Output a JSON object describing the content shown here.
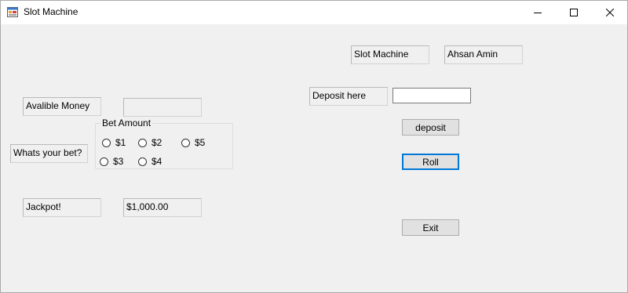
{
  "window": {
    "title": "Slot Machine",
    "minimize_glyph": "—",
    "maximize_glyph": "☐",
    "close_glyph": "✕"
  },
  "header": {
    "title_label": "Slot Machine",
    "author_label": "Ahsan Amin"
  },
  "money": {
    "label": "Avalible Money",
    "value": ""
  },
  "bet": {
    "question": "Whats your bet?",
    "group_title": "Bet Amount",
    "options": [
      "$1",
      "$2",
      "$5",
      "$3",
      "$4"
    ]
  },
  "jackpot": {
    "label": "Jackpot!",
    "value": "$1,000.00"
  },
  "deposit": {
    "label": "Deposit here",
    "input_value": "",
    "button_label": "deposit"
  },
  "actions": {
    "roll_label": "Roll",
    "exit_label": "Exit"
  },
  "colors": {
    "window_bg": "#f0f0f0",
    "titlebar_bg": "#ffffff",
    "default_button_border": "#0078d7"
  }
}
